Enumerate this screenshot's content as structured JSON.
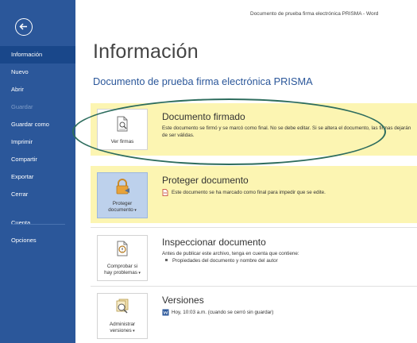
{
  "window": {
    "title": "Documento de prueba firma electrónica PRISMA - Word"
  },
  "sidebar": {
    "items": [
      {
        "label": "Información"
      },
      {
        "label": "Nuevo"
      },
      {
        "label": "Abrir"
      },
      {
        "label": "Guardar"
      },
      {
        "label": "Guardar como"
      },
      {
        "label": "Imprimir"
      },
      {
        "label": "Compartir"
      },
      {
        "label": "Exportar"
      },
      {
        "label": "Cerrar"
      },
      {
        "label": "Cuenta"
      },
      {
        "label": "Opciones"
      }
    ]
  },
  "main": {
    "heading": "Información",
    "document_name": "Documento de  prueba firma electrónica PRISMA",
    "sections": {
      "signed": {
        "tile_label": "Ver firmas",
        "title": "Documento firmado",
        "text": "Este documento se firmó y se marcó como final. No se debe editar. Si se altera el documento, las firmas dejarán de ser válidas."
      },
      "protect": {
        "tile_label_1": "Proteger",
        "tile_label_2": "documento",
        "title": "Proteger documento",
        "text": "Este documento se ha marcado como final para impedir que se edite."
      },
      "inspect": {
        "tile_label_1": "Comprobar si",
        "tile_label_2": "hay problemas",
        "title": "Inspeccionar documento",
        "text": "Antes de publicar este archivo, tenga en cuenta que contiene:",
        "bullet": "Propiedades del documento y nombre del autor"
      },
      "versions": {
        "tile_label_1": "Administrar",
        "tile_label_2": "versiones",
        "title": "Versiones",
        "text": "Hoy, 10:03 a.m. (cuando se cerró sin guardar)"
      }
    }
  },
  "colors": {
    "sidebar": "#2b579a",
    "highlight": "#fcf5b2",
    "accent_text": "#2b579a",
    "annotation_ellipse": "#2e6d5e"
  }
}
